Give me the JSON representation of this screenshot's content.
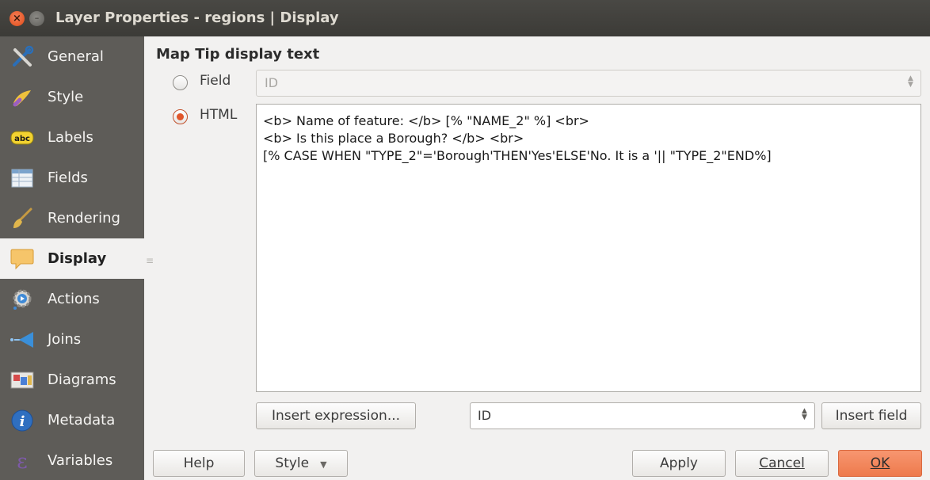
{
  "window": {
    "title": "Layer Properties - regions | Display",
    "close_glyph": "×",
    "minimize_glyph": "–"
  },
  "sidebar": {
    "items": [
      {
        "label": "General",
        "icon": "tools-icon"
      },
      {
        "label": "Style",
        "icon": "brush-icon"
      },
      {
        "label": "Labels",
        "icon": "abc-labels-icon"
      },
      {
        "label": "Fields",
        "icon": "table-icon"
      },
      {
        "label": "Rendering",
        "icon": "paintbrush-icon"
      },
      {
        "label": "Display",
        "icon": "speech-bubble-icon",
        "active": true
      },
      {
        "label": "Actions",
        "icon": "gear-play-icon"
      },
      {
        "label": "Joins",
        "icon": "joins-arrow-icon"
      },
      {
        "label": "Diagrams",
        "icon": "diagram-icon"
      },
      {
        "label": "Metadata",
        "icon": "info-icon"
      },
      {
        "label": "Variables",
        "icon": "epsilon-icon"
      }
    ]
  },
  "main": {
    "section_title": "Map Tip display text",
    "field_option": {
      "label": "Field",
      "checked": false
    },
    "field_combo_value": "ID",
    "html_option": {
      "label": "HTML",
      "checked": true
    },
    "html_lines": [
      "<b> Name of feature: </b> [% \"NAME_2\" %] <br>",
      "<b> Is this place a Borough? </b> <br>",
      "[% CASE WHEN \"TYPE_2\"='Borough'THEN'Yes'ELSE'No. It is a '|| \"TYPE_2\"END%]"
    ],
    "insert_expression_label": "Insert expression...",
    "field_select_value": "ID",
    "insert_field_label": "Insert field"
  },
  "footer": {
    "help_label": "Help",
    "style_label": "Style",
    "style_arrow": "▼",
    "apply_label": "Apply",
    "cancel_label": "Cancel",
    "ok_label": "OK"
  },
  "colors": {
    "accent": "#e0562b",
    "ok_button": "#f08458",
    "sidebar_bg": "#5e5c58",
    "titlebar_bg": "#3c3b37"
  }
}
